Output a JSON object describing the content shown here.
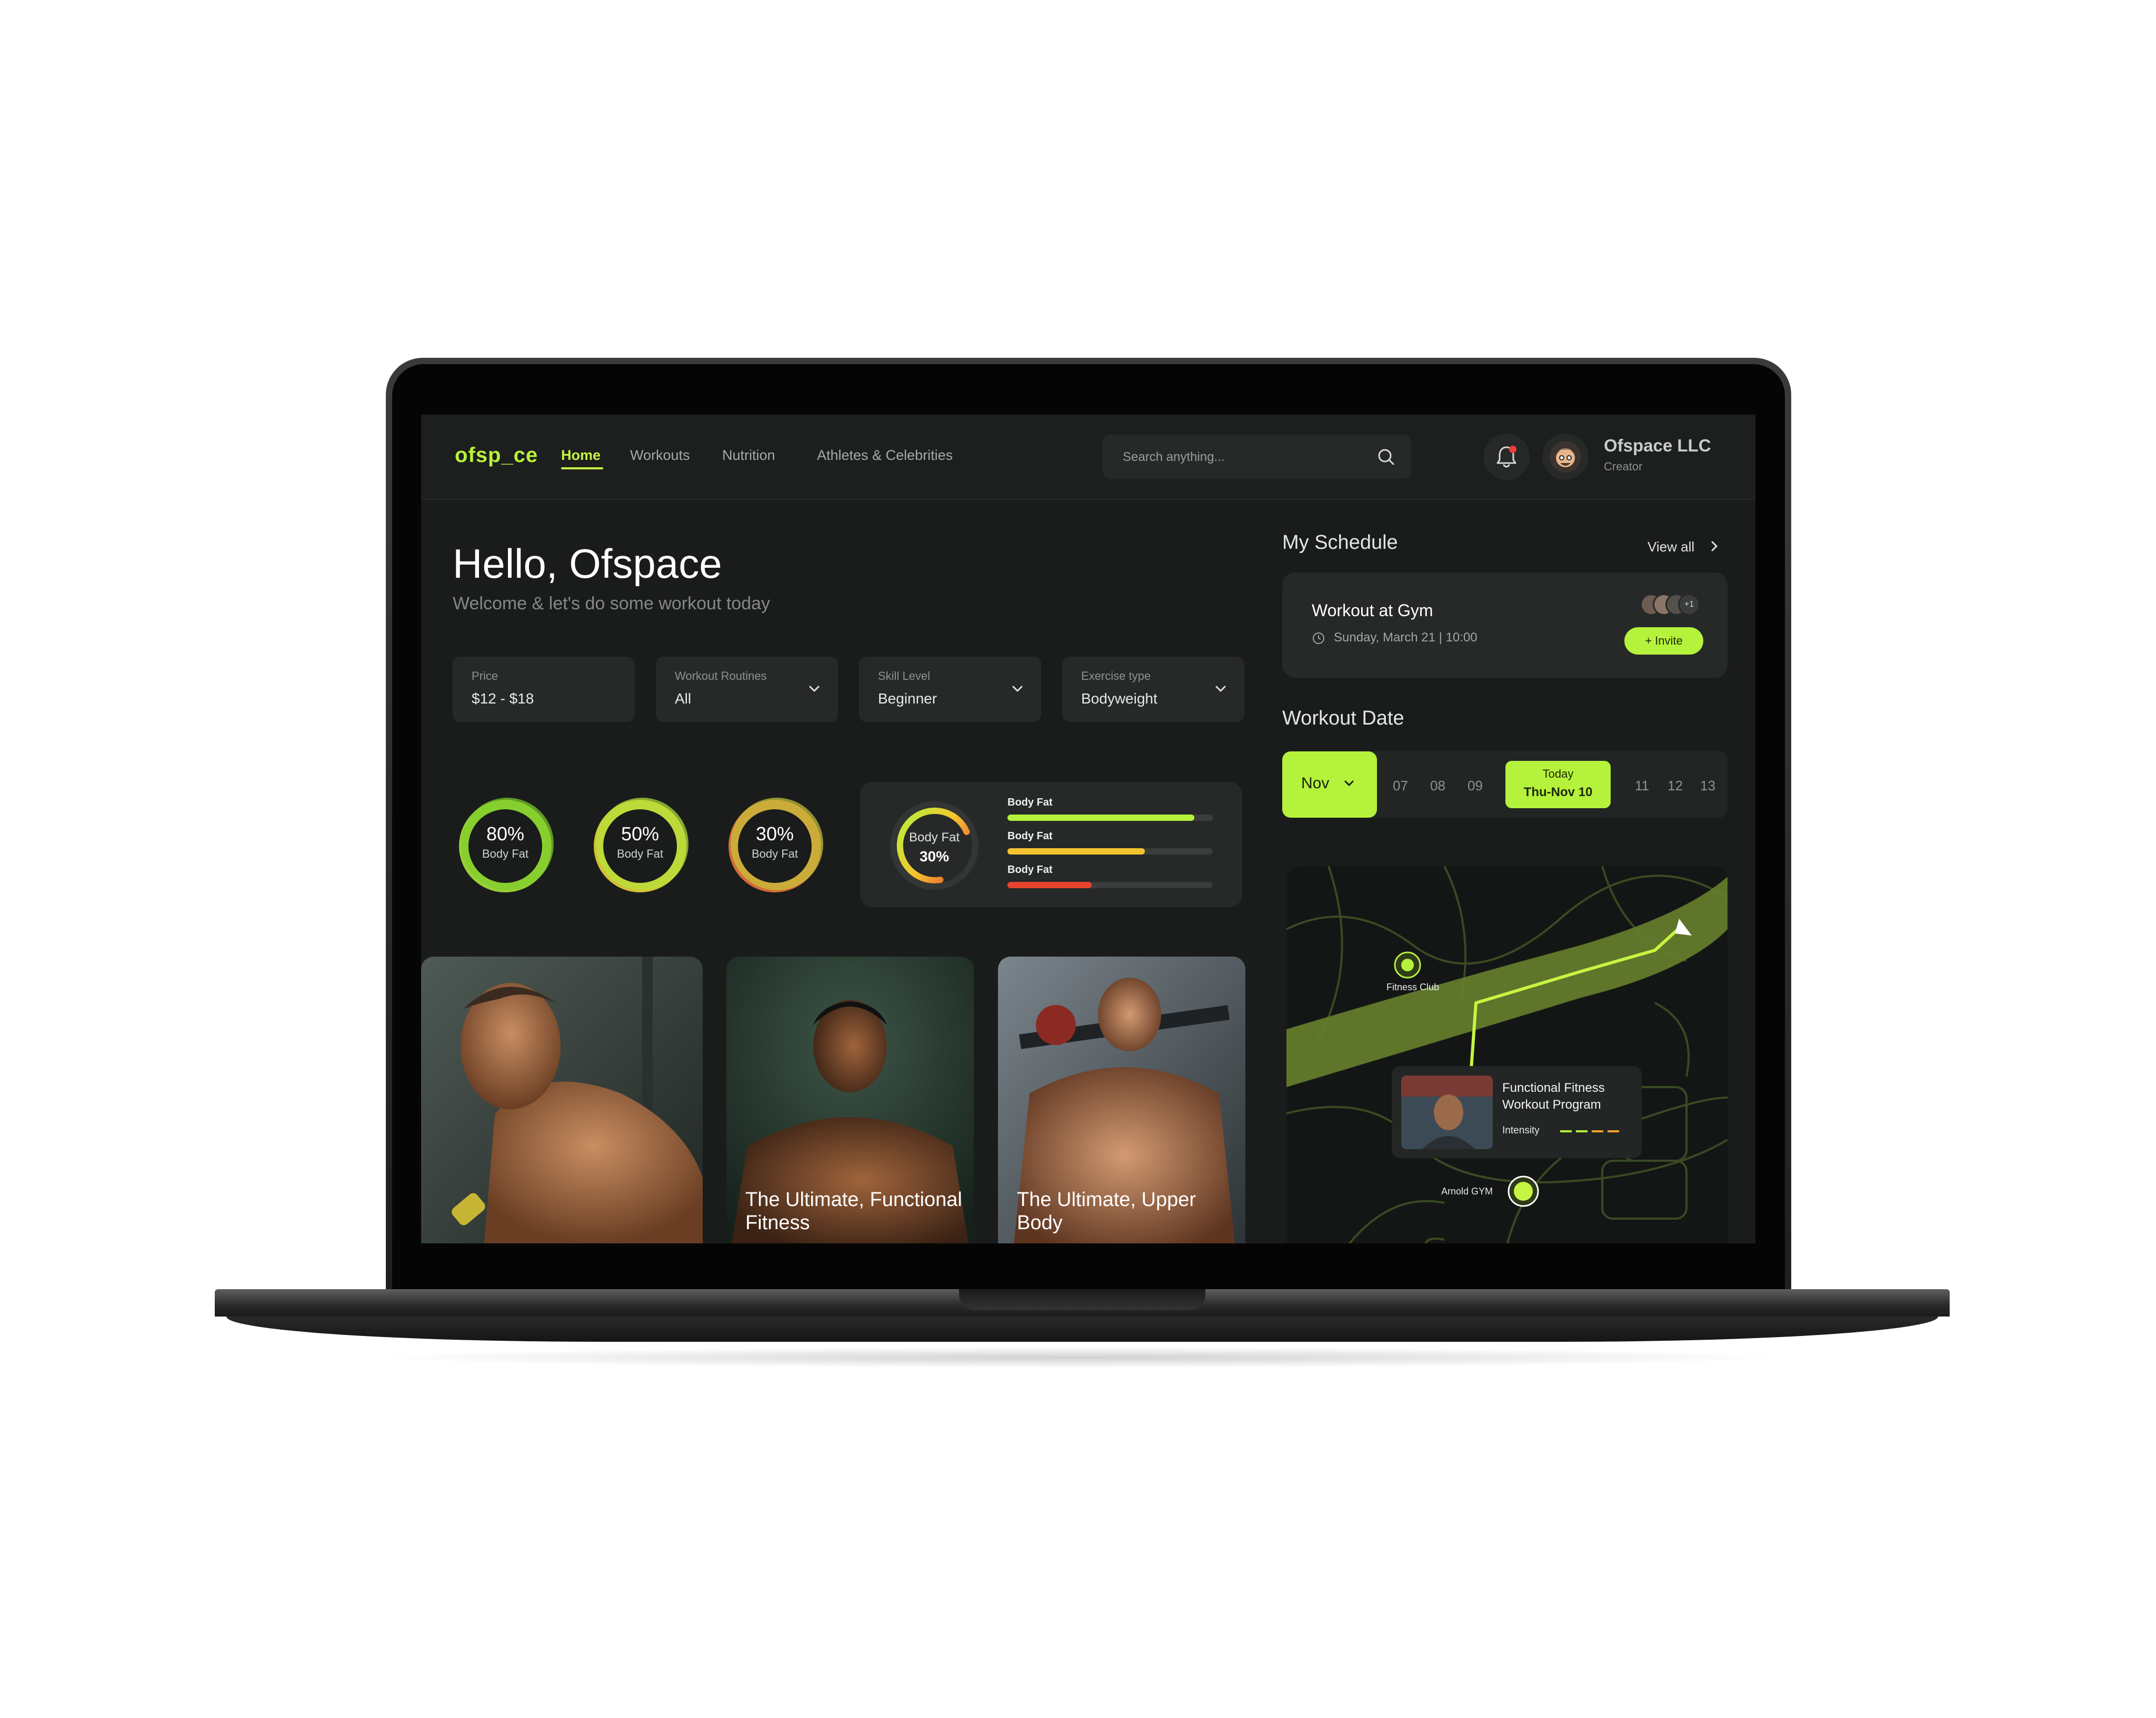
{
  "header": {
    "logo": "ofsp_ce",
    "nav": [
      "Home",
      "Workouts",
      "Nutrition",
      "Athletes & Celebrities"
    ],
    "active_nav": "Home",
    "search_placeholder": "Search anything...",
    "user_name": "Ofspace LLC",
    "user_role": "Creator"
  },
  "greeting": {
    "title": "Hello, Ofspace",
    "subtitle": "Welcome & let's do some workout today"
  },
  "filters": [
    {
      "label": "Price",
      "value": "$12 - $18"
    },
    {
      "label": "Workout Routines",
      "value": "All"
    },
    {
      "label": "Skill Level",
      "value": "Beginner"
    },
    {
      "label": "Exercise type",
      "value": "Bodyweight"
    }
  ],
  "rings": [
    {
      "value": "80%",
      "label": "Body Fat",
      "fraction": 0.8
    },
    {
      "value": "50%",
      "label": "Body Fat",
      "fraction": 0.5
    },
    {
      "value": "30%",
      "label": "Body Fat",
      "fraction": 0.3
    }
  ],
  "body_fat_card": {
    "gauge_label": "Body Fat",
    "gauge_value": "30%",
    "gauge_fraction": 0.3,
    "bars": [
      {
        "label": "Body Fat",
        "fraction": 0.91,
        "color": "#b5f23b"
      },
      {
        "label": "Body Fat",
        "fraction": 0.67,
        "color": "#f4c430"
      },
      {
        "label": "Body Fat",
        "fraction": 0.41,
        "color": "#e8432e"
      }
    ]
  },
  "cards": [
    {
      "title": ""
    },
    {
      "title": "The Ultimate, Functional Fitness"
    },
    {
      "title": "The Ultimate, Upper Body"
    }
  ],
  "schedule": {
    "title": "My Schedule",
    "view_all": "View all",
    "event": "Workout at Gym",
    "when": "Sunday, March 21  |  10:00",
    "extra_attendees": "+1",
    "invite": "+  Invite"
  },
  "workout_date": {
    "title": "Workout Date",
    "month": "Nov",
    "days_before": [
      "07",
      "08",
      "09"
    ],
    "today_label": "Today",
    "today_date": "Thu-Nov 10",
    "days_after": [
      "11",
      "12",
      "13"
    ]
  },
  "map": {
    "label_fitness_club": "Fitness Club",
    "label_arnold_gym": "Arnold GYM",
    "popup_title": "Functional Fitness Workout Program",
    "popup_intensity": "Intensity"
  },
  "colors": {
    "accent": "#b5f23b",
    "background": "#1a1c1b",
    "surface": "#262928"
  }
}
